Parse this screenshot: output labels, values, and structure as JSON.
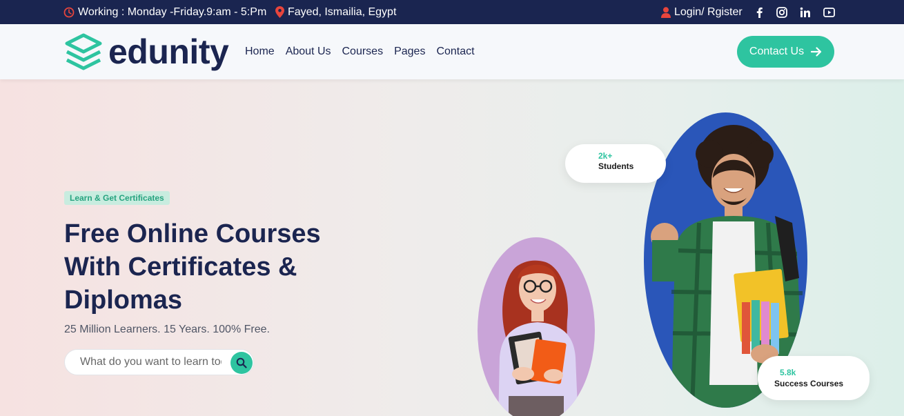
{
  "topbar": {
    "hours": "Working : Monday -Friday.9:am - 5:Pm",
    "location": "Fayed, Ismailia, Egypt",
    "login": "Login/ Rgister",
    "social_icons": [
      "facebook-icon",
      "instagram-icon",
      "linkedin-icon",
      "youtube-icon"
    ]
  },
  "brand": {
    "name": "edunity"
  },
  "nav": {
    "links": [
      "Home",
      "About Us",
      "Courses",
      "Pages",
      "Contact"
    ],
    "contact_button": "Contact Us"
  },
  "hero": {
    "badge": "Learn & Get Certificates",
    "headline": [
      "Free Online Courses",
      "With Certificates &",
      "Diplomas"
    ],
    "subtitle": "25 Million Learners. 15 Years. 100% Free.",
    "search_placeholder": "What do you want to learn today?"
  },
  "stats": {
    "students": {
      "value": "2k+",
      "label": "Students"
    },
    "courses": {
      "value": "5.8k",
      "label": "Success Courses"
    }
  },
  "colors": {
    "navy": "#1a2550",
    "accent": "#2ec4a0",
    "red_icon": "#e8453c"
  }
}
